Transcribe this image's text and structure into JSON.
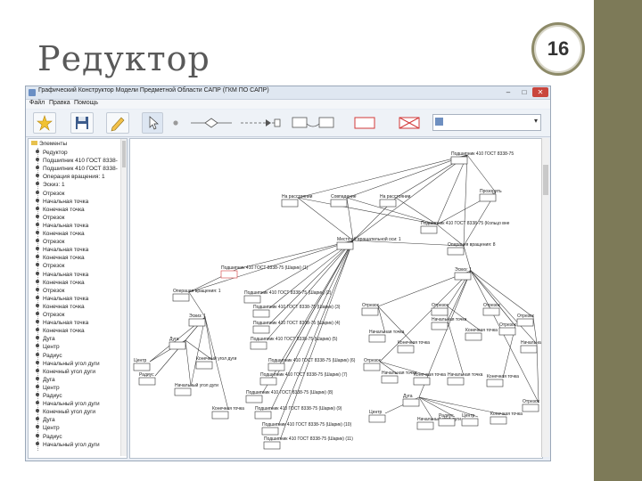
{
  "slide": {
    "title": "Редуктор",
    "page_number": "16"
  },
  "window": {
    "title": "Графический Конструктор Модели Предметной Области САПР (ГКМ ПО САПР)",
    "menu": [
      "Файл",
      "Правка",
      "Помощь"
    ],
    "toolbar_icons": [
      "wand-icon",
      "save-icon",
      "pencil-icon",
      "pointer-icon",
      "dot-icon",
      "diamond-line-icon",
      "arrow-connector-icon",
      "shape-connector-icon",
      "rectangle-icon",
      "cross-rectangle-icon"
    ]
  },
  "tree": {
    "root": "Элементы",
    "items": [
      "Редуктор",
      "Подшипник 410 ГОСТ 8338-",
      "Подшипник 410 ГОСТ 8338-",
      "Операция вращения: 1",
      "Эскиз: 1",
      "Отрезок",
      "Начальная точка",
      "Конечная точка",
      "Отрезок",
      "Начальная точка",
      "Конечная точка",
      "Отрезок",
      "Начальная точка",
      "Конечная точка",
      "Отрезок",
      "Начальная точка",
      "Конечная точка",
      "Отрезок",
      "Начальная точка",
      "Конечная точка",
      "Отрезок",
      "Начальная точка",
      "Конечная точка",
      "Дуга",
      "Центр",
      "Радиус",
      "Начальный угол дуги",
      "Конечный угол дуги",
      "Дуга",
      "Центр",
      "Радиус",
      "Начальный угол дуги",
      "Конечный угол дуги",
      "Дуга",
      "Центр",
      "Радиус",
      "Начальный угол дуги"
    ]
  },
  "diagram": {
    "nodes": [
      {
        "label": "Подшипник 410 ГОСТ 8338-75"
      },
      {
        "label": "На расстоянии"
      },
      {
        "label": "Совпадение"
      },
      {
        "label": "На расстоянии"
      },
      {
        "label": "Прозорить"
      },
      {
        "label": "Подшипник 410 ГОСТ 8338-75 (Кольцо вне"
      },
      {
        "label": "Место об вращательной оси: 1"
      },
      {
        "label": "Операция вращения: 8"
      },
      {
        "label": "Подшипник 410 ГОСТ 8338-75 (Шарик) (1)"
      },
      {
        "label": "Операция вращения: 1"
      },
      {
        "label": "Подшипник 410 ГОСТ 8338-75 (Шарик) (2)"
      },
      {
        "label": "Подшипник 410 ГОСТ 8338-75 (Шарик) (3)"
      },
      {
        "label": "Подшипник 410 ГОСТ 8338-75 (Шарик) (4)"
      },
      {
        "label": "Эскиз: 1"
      },
      {
        "label": "Эскиз: 1"
      },
      {
        "label": "Подшипник 410 ГОСТ 8338-75 (Шарик) (5)"
      },
      {
        "label": "Подшипник 410 ГОСТ 8338-75 (Шарик) (6)"
      },
      {
        "label": "Подшипник 410 ГОСТ 8338-75 (Шарик) (7)"
      },
      {
        "label": "Подшипник 410 ГОСТ 8338-75 (Шарик) (8)"
      },
      {
        "label": "Подшипник 410 ГОСТ 8338-75 (Шарик) (9)"
      },
      {
        "label": "Подшипник 410 ГОСТ 8338-75 (Шарик) (10)"
      },
      {
        "label": "Подшипник 410 ГОСТ 8338-75 (Шарик) (11)"
      },
      {
        "label": "Дуга"
      },
      {
        "label": "Центр"
      },
      {
        "label": "Конечный угол дуги"
      },
      {
        "label": "Радиус"
      },
      {
        "label": "Начальный угол дуги"
      },
      {
        "label": "Конечная точка"
      },
      {
        "label": "Отрезок"
      },
      {
        "label": "Отрезок"
      },
      {
        "label": "Отрезок"
      },
      {
        "label": "Начальная точка"
      },
      {
        "label": "Конечная точка"
      },
      {
        "label": "Начальная точка"
      },
      {
        "label": "Конечная точка"
      },
      {
        "label": "Отрезок"
      },
      {
        "label": "Отрезок"
      },
      {
        "label": "Начальная точка"
      },
      {
        "label": "Конечная точка"
      },
      {
        "label": "Начальная точка"
      },
      {
        "label": "Конечная точка"
      },
      {
        "label": "Дуга"
      },
      {
        "label": "Центр"
      },
      {
        "label": "Начальный угол дуги"
      },
      {
        "label": "Радиус"
      },
      {
        "label": "Центр"
      },
      {
        "label": "Конечная точка"
      },
      {
        "label": "Отрезок"
      },
      {
        "label": "Начальная точка"
      },
      {
        "label": "Отрезок"
      }
    ]
  }
}
